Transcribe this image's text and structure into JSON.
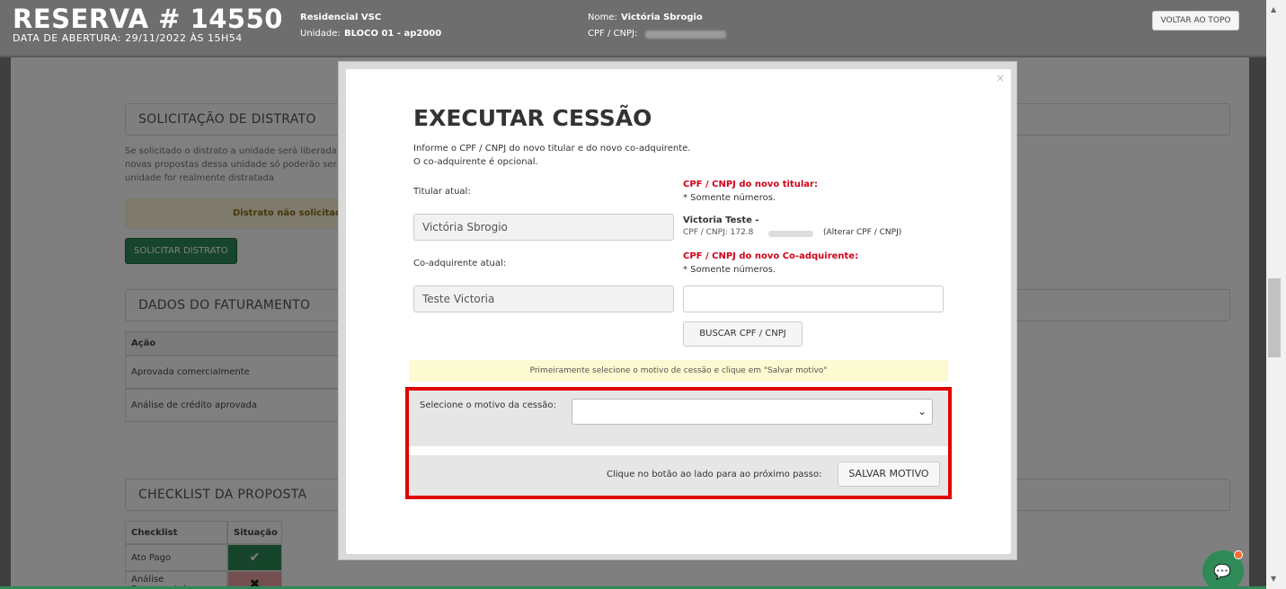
{
  "topbar": {
    "title": "RESERVA # 14550",
    "date": "DATA DE ABERTURA: 29/11/2022 ÀS 15H54",
    "residencial": "Residencial VSC",
    "unidade_label": "Unidade:",
    "unidade_value": "BLOCO 01 - ap2000",
    "nome_label": "Nome:",
    "nome_value": "Victória Sbrogio",
    "cpf_label": "CPF / CNPJ:",
    "back_to_top": "VOLTAR AO TOPO"
  },
  "background": {
    "distrato_header": "SOLICITAÇÃO DE DISTRATO",
    "distrato_text": [
      "Se solicitado o distrato a unidade será liberada p",
      "novas propostas dessa unidade só poderão ser v",
      "unidade for realmente distratada"
    ],
    "distrato_status": "Distrato não solicitado",
    "distrato_button": "SOLICITAR DISTRATO",
    "faturamento_header": "DADOS DO FATURAMENTO",
    "faturamento_col": "Ação",
    "faturamento_rows": [
      "Aprovada comercialmente",
      "Análise de crédito aprovada"
    ],
    "checklist_header": "CHECKLIST DA PROPOSTA",
    "checklist_cols": [
      "Checklist",
      "Situação"
    ],
    "checklist_rows": [
      "Ato Pago",
      "Análise Documental"
    ]
  },
  "modal": {
    "close": "×",
    "title": "EXECUTAR CESSÃO",
    "intro1": "Informe o CPF / CNPJ do novo titular e do novo co-adquirente.",
    "intro2": "O co-adquirente é opcional.",
    "titular_label": "Titular atual:",
    "titular_value": "Victória Sbrogio",
    "novo_titular_label": "CPF / CNPJ do novo titular:",
    "somente_numeros": "* Somente números.",
    "novo_titular_name": "Victoria Teste -",
    "novo_titular_cpf": "CPF / CNPJ: 172.8",
    "alterar": "(Alterar CPF / CNPJ)",
    "coadq_label": "Co-adquirente atual:",
    "coadq_value": "Teste Victoria",
    "novo_coadq_label": "CPF / CNPJ do novo Co-adquirente:",
    "somente_numeros2": "* Somente números.",
    "buscar": "BUSCAR CPF / CNPJ",
    "warning": "Primeiramente selecione o motivo de cessão e clique em \"Salvar motivo\"",
    "motivo_label": "Selecione o motivo da cessão:",
    "motivo_hint": "Clique no botão ao lado para ao próximo passo:",
    "salvar": "SALVAR MOTIVO"
  },
  "colors": {
    "accent_green": "#2e8b57",
    "highlight_red": "#e00000",
    "label_red": "#d0021b"
  }
}
